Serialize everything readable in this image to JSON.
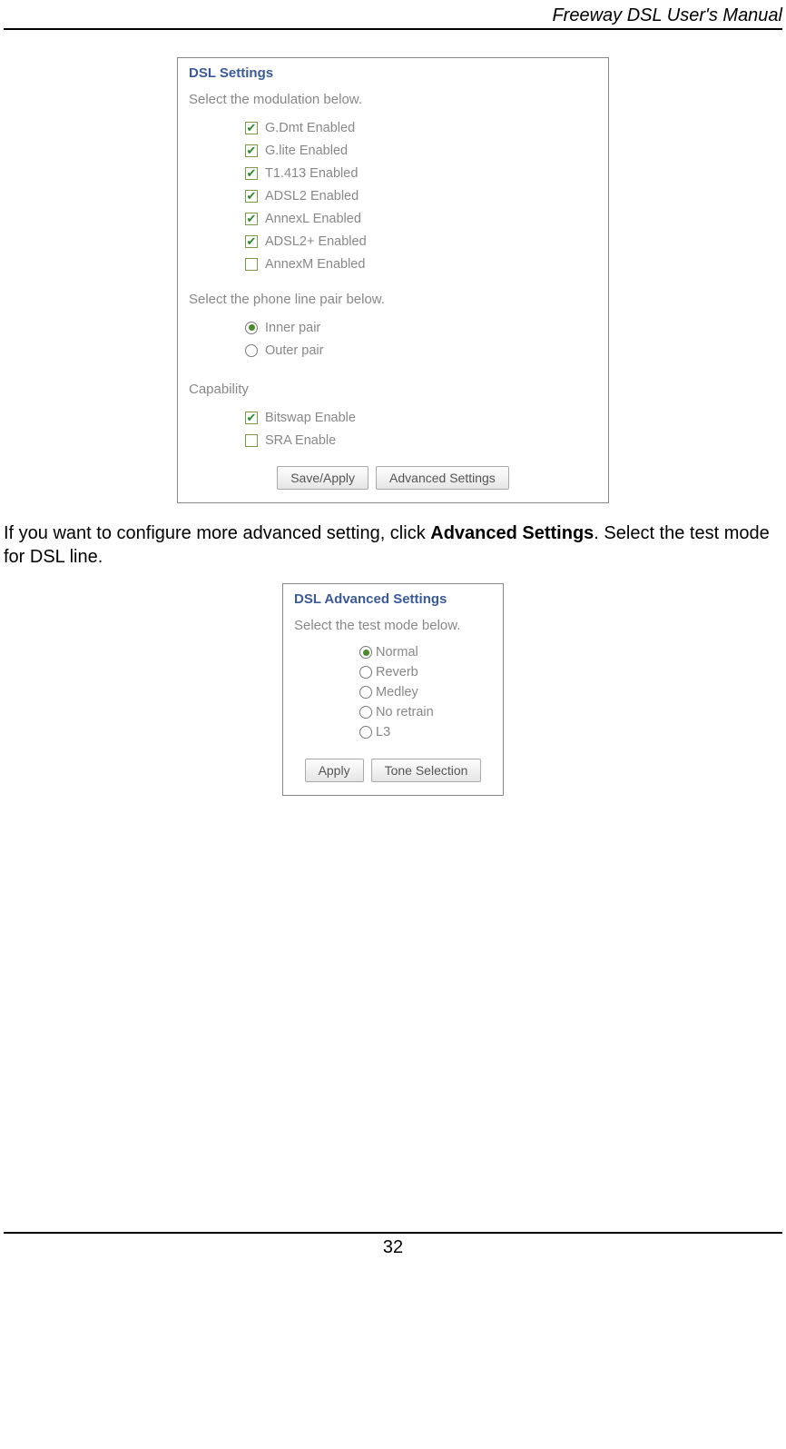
{
  "header": {
    "title": "Freeway DSL User's Manual"
  },
  "panel1": {
    "title": "DSL Settings",
    "modulation_prompt": "Select the modulation below.",
    "modulations": [
      {
        "label": "G.Dmt Enabled",
        "checked": true
      },
      {
        "label": "G.lite Enabled",
        "checked": true
      },
      {
        "label": "T1.413 Enabled",
        "checked": true
      },
      {
        "label": "ADSL2 Enabled",
        "checked": true
      },
      {
        "label": "AnnexL Enabled",
        "checked": true
      },
      {
        "label": "ADSL2+ Enabled",
        "checked": true
      },
      {
        "label": "AnnexM Enabled",
        "checked": false
      }
    ],
    "pair_prompt": "Select the phone line pair below.",
    "pairs": [
      {
        "label": "Inner pair",
        "selected": true
      },
      {
        "label": "Outer pair",
        "selected": false
      }
    ],
    "capability_prompt": "Capability",
    "capabilities": [
      {
        "label": "Bitswap Enable",
        "checked": true
      },
      {
        "label": "SRA Enable",
        "checked": false
      }
    ],
    "buttons": {
      "save": "Save/Apply",
      "advanced": "Advanced Settings"
    }
  },
  "body_text": {
    "part1": "If you want to configure more advanced setting, click ",
    "bold": "Advanced Settings",
    "part2": ". Select the test mode for DSL line."
  },
  "panel2": {
    "title": "DSL Advanced Settings",
    "prompt": "Select the test mode below.",
    "modes": [
      {
        "label": "Normal",
        "selected": true
      },
      {
        "label": "Reverb",
        "selected": false
      },
      {
        "label": "Medley",
        "selected": false
      },
      {
        "label": "No retrain",
        "selected": false
      },
      {
        "label": "L3",
        "selected": false
      }
    ],
    "buttons": {
      "apply": "Apply",
      "tone": "Tone Selection"
    }
  },
  "page_number": "32"
}
